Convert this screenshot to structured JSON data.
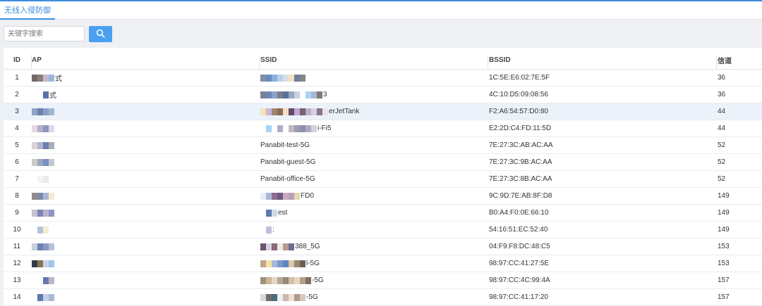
{
  "tab": {
    "label": "无线入侵防御"
  },
  "search": {
    "placeholder": "关键字搜索"
  },
  "table": {
    "headers": {
      "id": "ID",
      "ap": "AP",
      "ssid": "SSID",
      "bssid": "BSSID",
      "channel": "信道"
    },
    "rows": [
      {
        "id": "1",
        "ap": "式",
        "ssid": "",
        "bssid": "1C:5E:E6:02:7E:5F",
        "channel": "36",
        "ap_mask": [
          "#6f6a66",
          "#8a7f78",
          "#c8b9cf",
          "#9db7dc"
        ],
        "ssid_mask": [
          "#7f8fa8",
          "#6a8bc4",
          "#8ab0d8",
          "#b9d0ec",
          "#d9dde4",
          "#f0e2c2",
          "#6b7fa0",
          "#858585"
        ]
      },
      {
        "id": "2",
        "ap": "式",
        "ssid": "3",
        "bssid": "4C:10:D5:09:08:56",
        "channel": "36",
        "ap_mask": [
          "#ffffff",
          "#ffffff",
          "#5a72a8"
        ],
        "ssid_mask": [
          "#7a8199",
          "#6f86b3",
          "#8aa2c8",
          "#7a7f8f",
          "#5b6f9c",
          "#9aa8bf",
          "#c4d2e6",
          "#ffffff",
          "#a8d4f0",
          "#a9b7d0",
          "#7a7a7a"
        ]
      },
      {
        "id": "3",
        "ap": "",
        "ssid": "erJetTank",
        "bssid": "F2:A6:54:57:D0:80",
        "channel": "44",
        "ap_mask": [
          "#8fa4c2",
          "#6980b0",
          "#8a9ec8",
          "#a5b5cf"
        ],
        "ssid_mask": [
          "#f1e2b8",
          "#c9b8d2",
          "#a6856d",
          "#8e6a57",
          "#f3e0c6",
          "#5f4a6b",
          "#c0a8ce",
          "#7a5f6e",
          "#b9b3c9",
          "#d6cfe0",
          "#86768c",
          "#e8e3ea"
        ]
      },
      {
        "id": "4",
        "ap": "",
        "ssid": "i-Fi5",
        "bssid": "E2:2D:C4:FD:11:5D",
        "channel": "44",
        "ap_mask": [
          "#e3d9e6",
          "#b6b0c8",
          "#8b98be",
          "#dcd6e6"
        ],
        "ssid_mask": [
          "#ffffff",
          "#a6d4f2",
          "#ffffff",
          "#aab1c2",
          "#ffffff",
          "#c3b8c5",
          "#a09ab0",
          "#8f8fa8",
          "#b2a8c4",
          "#d8d0df"
        ]
      },
      {
        "id": "5",
        "ap": "",
        "ssid": "Panabit-test-5G",
        "bssid": "7E:27:3C:AB:AC:AA",
        "channel": "52",
        "ap_mask": [
          "#d9d2da",
          "#b0b5c8",
          "#6c7fae",
          "#a8aeb9"
        ],
        "ssid_mask": []
      },
      {
        "id": "6",
        "ap": "",
        "ssid": "Panabit-guest-5G",
        "bssid": "7E:27:3C:9B:AC:AA",
        "channel": "52",
        "ap_mask": [
          "#d0ccc4",
          "#9aa8c2",
          "#7a90bd",
          "#c2c8d4"
        ],
        "ssid_mask": []
      },
      {
        "id": "7",
        "ap": "",
        "ssid": "Panabit-office-5G",
        "bssid": "7E:27:3C:8B:AC:AA",
        "channel": "52",
        "ap_mask": [
          "#ffffff",
          "#f3f3f3",
          "#e9e9ee"
        ],
        "ssid_mask": []
      },
      {
        "id": "8",
        "ap": "",
        "ssid": "FD0",
        "bssid": "9C:9D:7E:AB:8F:D8",
        "channel": "149",
        "ap_mask": [
          "#8f8b8a",
          "#7f8aa8",
          "#a9b6d0",
          "#f1ecd0"
        ],
        "ssid_mask": [
          "#e8eef6",
          "#a9b9db",
          "#8c6f8e",
          "#6d5a7c",
          "#c9a8c0",
          "#b99fb8",
          "#e6d9b6"
        ]
      },
      {
        "id": "9",
        "ap": "",
        "ssid": "est",
        "bssid": "B0:A4:F0:0E:66:10",
        "channel": "149",
        "ap_mask": [
          "#c7c2d4",
          "#7f86b6",
          "#b6b4cc",
          "#8a97c2"
        ],
        "ssid_mask": [
          "#ffffff",
          "#5e78ad",
          "#d3d9e8"
        ]
      },
      {
        "id": "10",
        "ap": "",
        "ssid": ":",
        "bssid": "54:16:51:EC:52:40",
        "channel": "149",
        "ap_mask": [
          "#ffffff",
          "#b5c2dc",
          "#f3edd2"
        ],
        "ssid_mask": [
          "#ffffff",
          "#c2bdd8"
        ]
      },
      {
        "id": "11",
        "ap": "",
        "ssid": "388_5G",
        "bssid": "04:F9:F8:DC:48:C5",
        "channel": "153",
        "ap_mask": [
          "#c9cde0",
          "#6e82b4",
          "#8b9ac4",
          "#b9c1d8"
        ],
        "ssid_mask": [
          "#6c5470",
          "#d8cfe0",
          "#8a6a7c",
          "#f1e9e9",
          "#b79a8e",
          "#6a6e90"
        ]
      },
      {
        "id": "12",
        "ap": "",
        "ssid": "l-5G",
        "bssid": "98:97:CC:41:27:5E",
        "channel": "153",
        "ap_mask": [
          "#333a44",
          "#8a7056",
          "#c5d6ec",
          "#a2c4e6"
        ],
        "ssid_mask": [
          "#bfa58c",
          "#f2e2a6",
          "#a8b8d6",
          "#7a9acb",
          "#5f86c0",
          "#d8c9a8",
          "#9b8672",
          "#6f5e58"
        ]
      },
      {
        "id": "13",
        "ap": "",
        "ssid": "-5G",
        "bssid": "98:97:CC:4C:99:4A",
        "channel": "157",
        "ap_mask": [
          "#ffffff",
          "#ffffff",
          "#6978ab",
          "#b5b9c0"
        ],
        "ssid_mask": [
          "#a09078",
          "#c8b898",
          "#e0d8c8",
          "#b8a890",
          "#988878",
          "#d0c0a8",
          "#e8d8c0",
          "#b0a090",
          "#807060"
        ]
      },
      {
        "id": "14",
        "ap": "",
        "ssid": "-5G",
        "bssid": "98:97:CC:41:17:20",
        "channel": "157",
        "ap_mask": [
          "#ffffff",
          "#5f78b4",
          "#c4d2e8",
          "#a9b8d6"
        ],
        "ssid_mask": [
          "#d9d9d9",
          "#6b6f73",
          "#4c6a7c",
          "#eef0f0",
          "#c9b8b0",
          "#f0e0d0",
          "#b09a90",
          "#d8c8c0"
        ]
      }
    ]
  },
  "colors": {
    "accent": "#3c8dde",
    "search_button": "#4a9ff0",
    "highlight_row": "#ecf2fa"
  },
  "icons": {
    "search_button": "search-icon"
  },
  "highlighted_row_index": 2
}
